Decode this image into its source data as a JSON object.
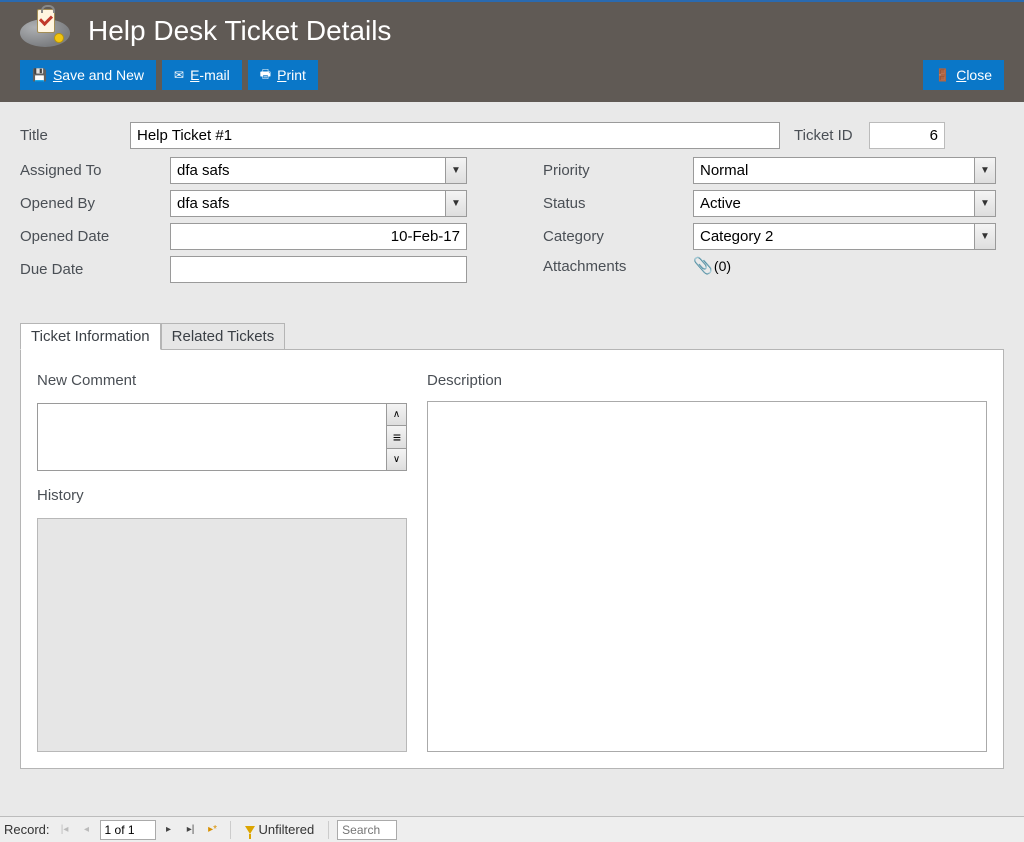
{
  "header": {
    "title": "Help Desk Ticket Details"
  },
  "toolbar": {
    "save_new": "Save and New",
    "email": "E-mail",
    "print": "Print",
    "close": "Close"
  },
  "labels": {
    "title": "Title",
    "ticket_id": "Ticket ID",
    "assigned_to": "Assigned To",
    "opened_by": "Opened By",
    "opened_date": "Opened Date",
    "due_date": "Due Date",
    "priority": "Priority",
    "status": "Status",
    "category": "Category",
    "attachments": "Attachments"
  },
  "fields": {
    "title": "Help Ticket #1",
    "ticket_id": "6",
    "assigned_to": "dfa safs",
    "opened_by": "dfa safs",
    "opened_date": "10-Feb-17",
    "due_date": "",
    "priority": "Normal",
    "status": "Active",
    "category": "Category 2",
    "attachments": "(0)"
  },
  "tabs": {
    "ticket_info": "Ticket Information",
    "related": "Related Tickets"
  },
  "sections": {
    "new_comment": "New Comment",
    "history": "History",
    "description": "Description"
  },
  "recordbar": {
    "label": "Record:",
    "position": "1 of 1",
    "filter": "Unfiltered",
    "search_placeholder": "Search"
  }
}
